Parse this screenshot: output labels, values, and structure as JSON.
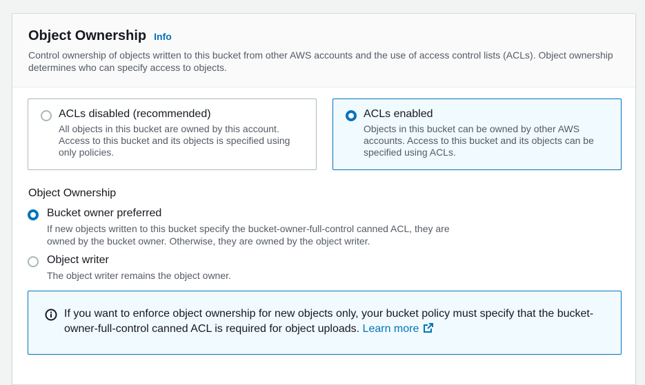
{
  "header": {
    "title": "Object Ownership",
    "info_link": "Info",
    "description": "Control ownership of objects written to this bucket from other AWS accounts and the use of access control lists (ACLs). Object ownership determines who can specify access to objects."
  },
  "acl_tiles": [
    {
      "label": "ACLs disabled (recommended)",
      "description": "All objects in this bucket are owned by this account. Access to this bucket and its objects is specified using only policies.",
      "selected": false
    },
    {
      "label": "ACLs enabled",
      "description": "Objects in this bucket can be owned by other AWS accounts. Access to this bucket and its objects can be specified using ACLs.",
      "selected": true
    }
  ],
  "ownership": {
    "label": "Object Ownership",
    "options": [
      {
        "label": "Bucket owner preferred",
        "description": "If new objects written to this bucket specify the bucket-owner-full-control canned ACL, they are owned by the bucket owner. Otherwise, they are owned by the object writer.",
        "selected": true
      },
      {
        "label": "Object writer",
        "description": "The object writer remains the object owner.",
        "selected": false
      }
    ]
  },
  "alert": {
    "icon": "info-circle-icon",
    "text": "If you want to enforce object ownership for new objects only, your bucket policy must specify that the bucket-owner-full-control canned ACL is required for object uploads.",
    "link_text": "Learn more",
    "link_icon": "external-link-icon"
  },
  "colors": {
    "accent": "#0073bb",
    "selected_bg": "#f1faff",
    "border": "#aab7b8"
  }
}
